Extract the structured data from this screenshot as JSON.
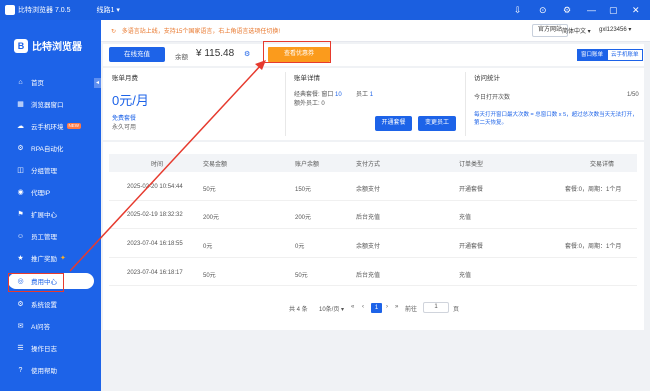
{
  "titlebar": {
    "title": "比特浏览器 7.0.5",
    "line": "线路1 ▾",
    "controls": [
      "⇩",
      "⊙",
      "⚙",
      "—",
      "▢",
      "✕"
    ]
  },
  "brand": {
    "logo_letter": "B",
    "name": "比特浏览器"
  },
  "sidebar": {
    "collapse": "◂",
    "items": [
      {
        "label": "首页",
        "icon": "⌂"
      },
      {
        "label": "浏览器窗口",
        "icon": "▦"
      },
      {
        "label": "云手机环境",
        "icon": "☁",
        "badge": "NEW"
      },
      {
        "label": "RPA自动化",
        "icon": "⚙"
      },
      {
        "label": "分组管理",
        "icon": "◫"
      },
      {
        "label": "代理IP",
        "icon": "◉"
      },
      {
        "label": "扩展中心",
        "icon": "⚑"
      },
      {
        "label": "员工管理",
        "icon": "☺"
      },
      {
        "label": "推广奖励",
        "icon": "★",
        "spark": "✦"
      },
      {
        "label": "费用中心",
        "icon": "◎"
      },
      {
        "label": "系统设置",
        "icon": "⚙"
      },
      {
        "label": "AI问答",
        "icon": "✉"
      },
      {
        "label": "操作日志",
        "icon": "☰"
      },
      {
        "label": "使用帮助",
        "icon": "?"
      }
    ]
  },
  "topbar": {
    "notice_icon": "↻",
    "notice": "多语言站上线，支持15个国家语言，右上角语言选项任切换!",
    "site_button": "官方网站",
    "lang": "简体中文 ▾",
    "user": "gxl123456 ▾"
  },
  "balance": {
    "recharge_button": "在线充值",
    "label": "余额",
    "value": "¥ 115.48",
    "refresh_icon": "⚙",
    "offers_button": "查看优惠券"
  },
  "right_tabs": {
    "window_bill": "窗口账单",
    "phone_bill": "云手机账单"
  },
  "monthly": {
    "title": "账单月费",
    "value": "0元/月",
    "package": "免费套餐",
    "duration": "永久可用"
  },
  "account": {
    "title": "账单详情",
    "package_label": "经典套餐: 窗口",
    "package_value": "10",
    "staff_label": "员工",
    "staff_value": "1",
    "extra_staff": "额外员工: 0",
    "open_package": "开通套餐",
    "change_staff": "变更员工"
  },
  "visits": {
    "title": "访问统计",
    "today_label": "今日打开次数",
    "today_value": "1/50",
    "note": "每天打开窗口最大次数 = 总窗口数 x 5，超过总次数当天无法打开，第二天恢复。"
  },
  "table": {
    "headers": [
      "时间",
      "交易金额",
      "账户余额",
      "支付方式",
      "订单类型",
      "交易详情"
    ],
    "rows": [
      {
        "time": "2025-02-20 10:54:44",
        "amount": "50元",
        "balance": "150元",
        "method": "余额支付",
        "type": "开通套餐",
        "detail": "套餐:0，周期：1个月"
      },
      {
        "time": "2025-02-19 18:32:32",
        "amount": "200元",
        "balance": "200元",
        "method": "后台充值",
        "type": "充值",
        "detail": ""
      },
      {
        "time": "2023-07-04 16:18:55",
        "amount": "0元",
        "balance": "0元",
        "method": "余额支付",
        "type": "开通套餐",
        "detail": "套餐:0，周期：1个月"
      },
      {
        "time": "2023-07-04 16:18:17",
        "amount": "50元",
        "balance": "50元",
        "method": "后台充值",
        "type": "充值",
        "detail": ""
      }
    ]
  },
  "pager": {
    "total": "共 4 条",
    "page_size": "10条/页 ▾",
    "first": "«",
    "prev": "‹",
    "current": "1",
    "next": "›",
    "last": "»",
    "goto_label": "前往",
    "goto_value": "1",
    "page_label": "页"
  },
  "colors": {
    "primary": "#1d63e8",
    "orange": "#fb9b1c",
    "highlight": "#e63a2e"
  }
}
